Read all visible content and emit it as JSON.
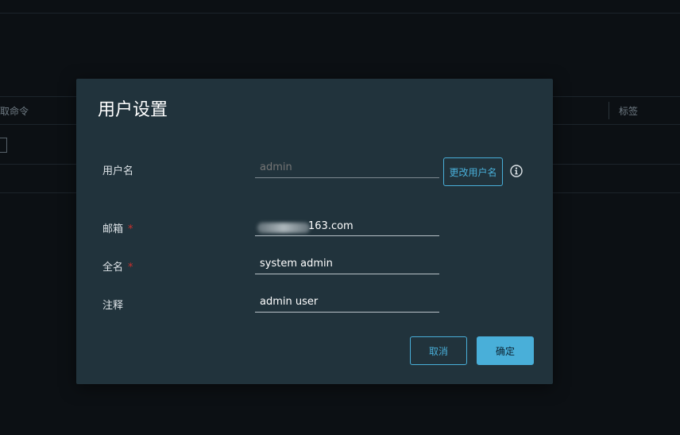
{
  "background": {
    "column_left_text": "取命令",
    "column_right_text": "标签"
  },
  "dialog": {
    "title": "用户设置",
    "username": {
      "label": "用户名",
      "placeholder": "admin",
      "change_button": "更改用户名",
      "info_icon": "info-circle-icon"
    },
    "email": {
      "label": "邮箱",
      "required_mark": "*",
      "value": "163.com"
    },
    "fullname": {
      "label": "全名",
      "required_mark": "*",
      "value": "system admin"
    },
    "note": {
      "label": "注释",
      "value": "admin user"
    },
    "cancel_button": "取消",
    "confirm_button": "确定"
  },
  "colors": {
    "accent": "#49afd9",
    "dialog_bg": "#21333c",
    "page_bg": "#0c1014",
    "required": "#c9302c"
  }
}
